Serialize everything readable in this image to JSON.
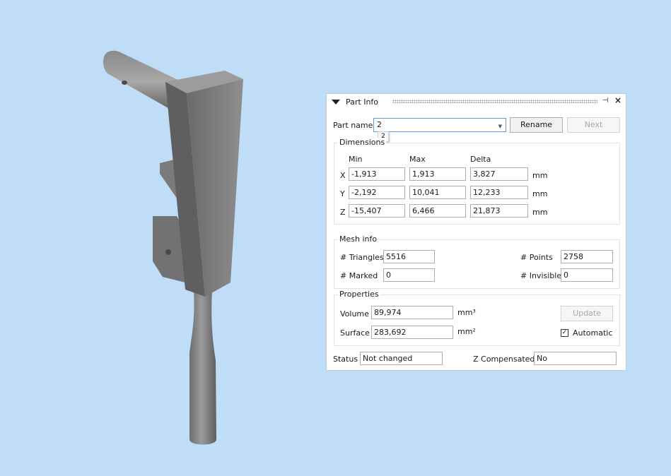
{
  "panel": {
    "title": "Part Info",
    "part_name_label": "Part name",
    "part_name_value": "2",
    "part_name_tooltip": "2",
    "rename_button": "Rename",
    "next_button": "Next"
  },
  "dimensions": {
    "title": "Dimensions",
    "headers": [
      "Min",
      "Max",
      "Delta"
    ],
    "rows": [
      {
        "axis": "X",
        "min": "-1,913",
        "max": "1,913",
        "delta": "3,827",
        "unit": "mm"
      },
      {
        "axis": "Y",
        "min": "-2,192",
        "max": "10,041",
        "delta": "12,233",
        "unit": "mm"
      },
      {
        "axis": "Z",
        "min": "-15,407",
        "max": "6,466",
        "delta": "21,873",
        "unit": "mm"
      }
    ]
  },
  "mesh": {
    "title": "Mesh info",
    "triangles_label": "# Triangles",
    "triangles_value": "5516",
    "points_label": "# Points",
    "points_value": "2758",
    "marked_label": "# Marked",
    "marked_value": "0",
    "invisible_label": "# Invisible",
    "invisible_value": "0"
  },
  "properties": {
    "title": "Properties",
    "volume_label": "Volume",
    "volume_value": "89,974",
    "volume_unit": "mm³",
    "surface_label": "Surface",
    "surface_value": "283,692",
    "surface_unit": "mm²",
    "update_button": "Update",
    "automatic_label": "Automatic",
    "automatic_checked": true
  },
  "status": {
    "status_label": "Status",
    "status_value": "Not changed",
    "zcomp_label": "Z Compensated",
    "zcomp_value": "No"
  },
  "colors": {
    "viewport_background": "#bfddf6",
    "model_gray": "#8a8a8a"
  }
}
